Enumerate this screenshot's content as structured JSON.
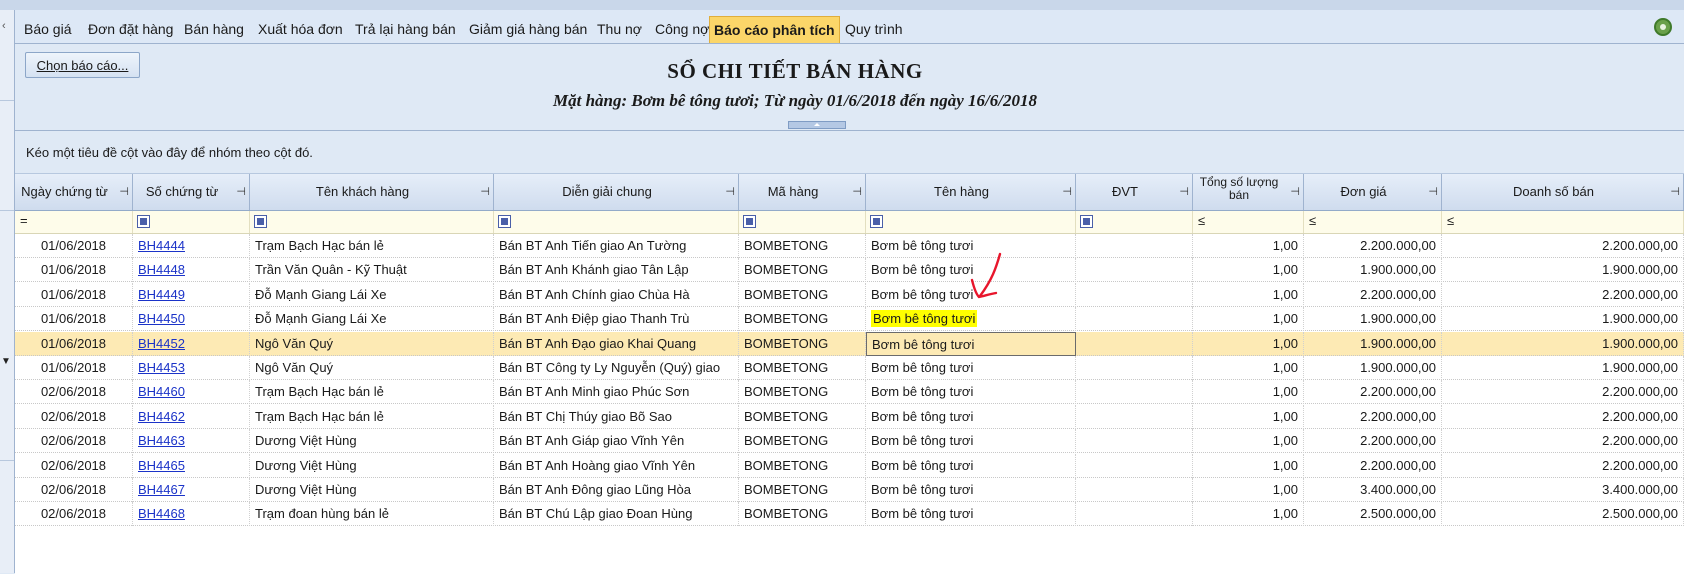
{
  "tabs": [
    {
      "label": "Báo giá",
      "active": false
    },
    {
      "label": "Đơn đặt hàng",
      "active": false
    },
    {
      "label": "Bán hàng",
      "active": false
    },
    {
      "label": "Xuất hóa đơn",
      "active": false
    },
    {
      "label": "Trả lại hàng bán",
      "active": false
    },
    {
      "label": "Giảm giá hàng bán",
      "active": false
    },
    {
      "label": "Thu nợ",
      "active": false
    },
    {
      "label": "Công nợ",
      "active": false
    },
    {
      "label": "Báo cáo phân tích",
      "active": true
    },
    {
      "label": "Quy trình",
      "active": false
    }
  ],
  "report": {
    "choose_button": "Chọn báo cáo...",
    "title": "SỔ CHI TIẾT BÁN HÀNG",
    "subtitle": "Mặt hàng: Bơm bê tông tươi; Từ ngày 01/6/2018 đến ngày 16/6/2018"
  },
  "grid": {
    "group_hint": "Kéo một tiêu đề cột vào đây để nhóm theo cột đó.",
    "columns": [
      "Ngày chứng từ",
      "Số chứng từ",
      "Tên khách hàng",
      "Diễn giải chung",
      "Mã hàng",
      "Tên hàng",
      "ĐVT",
      "Tổng số lượng bán",
      "Đơn giá",
      "Doanh số bán"
    ],
    "filter_ops": [
      "=",
      "",
      "",
      "",
      "",
      "",
      "",
      "≤",
      "≤",
      "≤"
    ],
    "rows": [
      {
        "date": "01/06/2018",
        "doc": "BH4444",
        "customer": "Trạm Bạch Hạc bán lẻ",
        "desc": "Bán BT Anh Tiến giao An Tường",
        "code": "BOMBETONG",
        "item": "Bơm bê tông tươi",
        "unit": "",
        "qty": "1,00",
        "price": "2.200.000,00",
        "sales": "2.200.000,00"
      },
      {
        "date": "01/06/2018",
        "doc": "BH4448",
        "customer": "Trần Văn Quân - Kỹ Thuật",
        "desc": "Bán BT Anh Khánh giao Tân Lập",
        "code": "BOMBETONG",
        "item": "Bơm bê tông tươi",
        "unit": "",
        "qty": "1,00",
        "price": "1.900.000,00",
        "sales": "1.900.000,00"
      },
      {
        "date": "01/06/2018",
        "doc": "BH4449",
        "customer": "Đỗ Mạnh Giang Lái Xe",
        "desc": "Bán BT Anh Chính giao Chùa Hà",
        "code": "BOMBETONG",
        "item": "Bơm bê tông tươi",
        "unit": "",
        "qty": "1,00",
        "price": "2.200.000,00",
        "sales": "2.200.000,00"
      },
      {
        "date": "01/06/2018",
        "doc": "BH4450",
        "customer": "Đỗ Mạnh Giang Lái Xe",
        "desc": "Bán BT Anh Điệp giao Thanh Trù",
        "code": "BOMBETONG",
        "item": "Bơm bê tông tươi",
        "unit": "",
        "qty": "1,00",
        "price": "1.900.000,00",
        "sales": "1.900.000,00"
      },
      {
        "date": "01/06/2018",
        "doc": "BH4452",
        "customer": "Ngô Văn Quý",
        "desc": "Bán BT Anh Đạo giao Khai Quang",
        "code": "BOMBETONG",
        "item": "Bơm bê tông tươi",
        "unit": "",
        "qty": "1,00",
        "price": "1.900.000,00",
        "sales": "1.900.000,00"
      },
      {
        "date": "01/06/2018",
        "doc": "BH4453",
        "customer": "Ngô Văn Quý",
        "desc": "Bán BT Công ty Ly Nguyễn (Quý) giao",
        "code": "BOMBETONG",
        "item": "Bơm bê tông tươi",
        "unit": "",
        "qty": "1,00",
        "price": "1.900.000,00",
        "sales": "1.900.000,00"
      },
      {
        "date": "02/06/2018",
        "doc": "BH4460",
        "customer": "Trạm Bạch Hạc bán lẻ",
        "desc": "Bán BT Anh Minh giao Phúc Sơn",
        "code": "BOMBETONG",
        "item": "Bơm bê tông tươi",
        "unit": "",
        "qty": "1,00",
        "price": "2.200.000,00",
        "sales": "2.200.000,00"
      },
      {
        "date": "02/06/2018",
        "doc": "BH4462",
        "customer": "Trạm Bạch Hạc bán lẻ",
        "desc": "Bán BT Chị Thúy giao Bõ Sao",
        "code": "BOMBETONG",
        "item": "Bơm bê tông tươi",
        "unit": "",
        "qty": "1,00",
        "price": "2.200.000,00",
        "sales": "2.200.000,00"
      },
      {
        "date": "02/06/2018",
        "doc": "BH4463",
        "customer": "Dương Việt Hùng",
        "desc": "Bán BT Anh Giáp giao Vĩnh Yên",
        "code": "BOMBETONG",
        "item": "Bơm bê tông tươi",
        "unit": "",
        "qty": "1,00",
        "price": "2.200.000,00",
        "sales": "2.200.000,00"
      },
      {
        "date": "02/06/2018",
        "doc": "BH4465",
        "customer": "Dương Việt Hùng",
        "desc": "Bán BT Anh Hoàng giao Vĩnh Yên",
        "code": "BOMBETONG",
        "item": "Bơm bê tông tươi",
        "unit": "",
        "qty": "1,00",
        "price": "2.200.000,00",
        "sales": "2.200.000,00"
      },
      {
        "date": "02/06/2018",
        "doc": "BH4467",
        "customer": "Dương Việt Hùng",
        "desc": "Bán BT Anh Đông giao Lũng Hòa",
        "code": "BOMBETONG",
        "item": "Bơm bê tông tươi",
        "unit": "",
        "qty": "1,00",
        "price": "3.400.000,00",
        "sales": "3.400.000,00"
      },
      {
        "date": "02/06/2018",
        "doc": "BH4468",
        "customer": "Trạm đoan hùng bán lẻ",
        "desc": "Bán BT Chú Lập giao Đoan Hùng",
        "code": "BOMBETONG",
        "item": "Bơm bê tông tươi",
        "unit": "",
        "qty": "1,00",
        "price": "2.500.000,00",
        "sales": "2.500.000,00"
      }
    ]
  },
  "colors": {
    "active_tab": "#fbd669",
    "selected_row": "#fdeab4",
    "highlight": "#ffff00",
    "link": "#1b33c8",
    "annotation_arrow": "#e8162c"
  },
  "icons": {
    "settings": "gear-icon",
    "pin": "pin-icon",
    "filter": "filter-icon"
  }
}
